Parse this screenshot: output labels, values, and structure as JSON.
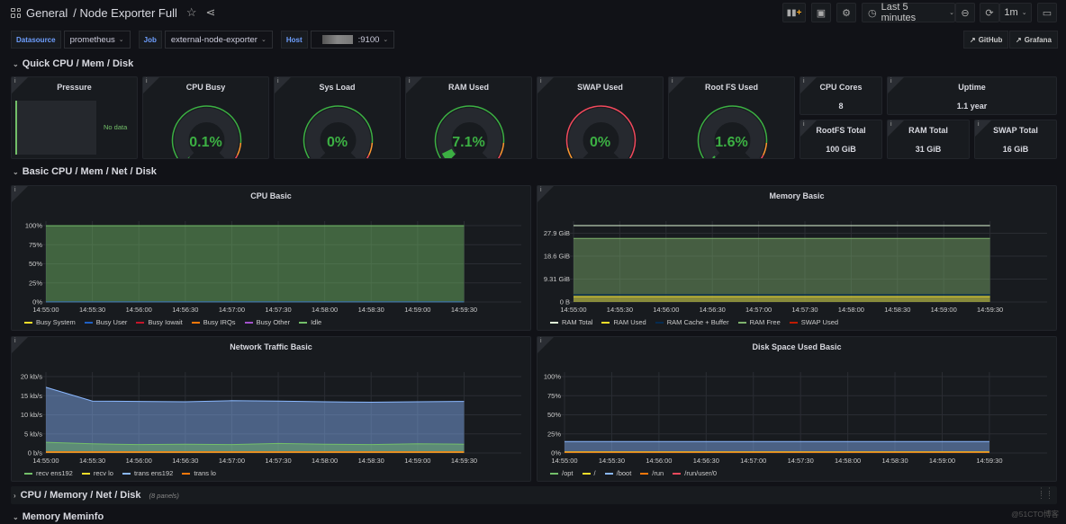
{
  "header": {
    "breadcrumb_folder": "General",
    "breadcrumb_dashboard": "/ Node Exporter Full",
    "time_range": "Last 5 minutes",
    "refresh_interval": "1m",
    "icons": [
      "add-panel-icon",
      "save-icon",
      "settings-icon",
      "clock-icon",
      "zoom-out-icon",
      "refresh-icon",
      "tv-mode-icon"
    ]
  },
  "variables": [
    {
      "label": "Datasource",
      "value": "prometheus"
    },
    {
      "label": "Job",
      "value": "external-node-exporter"
    },
    {
      "label": "Host",
      "value": ":9100"
    }
  ],
  "links": [
    {
      "label": "GitHub"
    },
    {
      "label": "Grafana"
    }
  ],
  "rows": {
    "quick": "Quick CPU / Mem / Disk",
    "basic": "Basic CPU / Mem / Net / Disk",
    "cpu_mem": "CPU / Memory / Net / Disk",
    "cpu_mem_count": "(8 panels)",
    "meminfo": "Memory Meminfo"
  },
  "stats": {
    "pressure": {
      "title": "Pressure",
      "value": "No data"
    },
    "cpu_busy": {
      "title": "CPU Busy",
      "value": "0.1%",
      "fraction": 0.001
    },
    "sys_load": {
      "title": "Sys Load",
      "value": "0%",
      "fraction": 0
    },
    "ram_used": {
      "title": "RAM Used",
      "value": "7.1%",
      "fraction": 0.071
    },
    "swap_used": {
      "title": "SWAP Used",
      "value": "0%",
      "fraction": 0
    },
    "root_fs_used": {
      "title": "Root FS Used",
      "value": "1.6%",
      "fraction": 0.016
    },
    "cpu_cores": {
      "title": "CPU Cores",
      "value": "8"
    },
    "uptime": {
      "title": "Uptime",
      "value": "1.1 year"
    },
    "rootfs_total": {
      "title": "RootFS Total",
      "value": "100 GiB"
    },
    "ram_total": {
      "title": "RAM Total",
      "value": "31 GiB"
    },
    "swap_total": {
      "title": "SWAP Total",
      "value": "16 GiB"
    }
  },
  "watermark": "@51CTO博客",
  "chart_data": [
    {
      "type": "area",
      "title": "CPU Basic",
      "x": [
        "14:55:00",
        "14:55:30",
        "14:56:00",
        "14:56:30",
        "14:57:00",
        "14:57:30",
        "14:58:00",
        "14:58:30",
        "14:59:00",
        "14:59:30"
      ],
      "yticks": [
        "0%",
        "25%",
        "50%",
        "75%",
        "100%"
      ],
      "ylim": [
        0,
        100
      ],
      "series": [
        {
          "name": "Busy System",
          "color": "#fade2a",
          "values": [
            0.1,
            0.1,
            0.1,
            0.1,
            0.1,
            0.1,
            0.1,
            0.1,
            0.1,
            0.1
          ]
        },
        {
          "name": "Busy User",
          "color": "#1f60c4",
          "values": [
            0.1,
            0.1,
            0.1,
            0.1,
            0.1,
            0.1,
            0.1,
            0.1,
            0.1,
            0.1
          ]
        },
        {
          "name": "Busy Iowait",
          "color": "#c4162a",
          "values": [
            0,
            0,
            0,
            0,
            0,
            0,
            0,
            0,
            0,
            0
          ]
        },
        {
          "name": "Busy IRQs",
          "color": "#ff780a",
          "values": [
            0,
            0,
            0,
            0,
            0,
            0,
            0,
            0,
            0,
            0
          ]
        },
        {
          "name": "Busy Other",
          "color": "#a352cc",
          "values": [
            0,
            0,
            0,
            0,
            0,
            0,
            0,
            0,
            0,
            0
          ]
        },
        {
          "name": "Idle",
          "color": "#73bf69",
          "values": [
            99.8,
            99.8,
            99.8,
            99.8,
            99.8,
            99.8,
            99.8,
            99.8,
            99.8,
            99.8
          ]
        }
      ]
    },
    {
      "type": "area",
      "title": "Memory Basic",
      "x": [
        "14:55:00",
        "14:55:30",
        "14:56:00",
        "14:56:30",
        "14:57:00",
        "14:57:30",
        "14:58:00",
        "14:58:30",
        "14:59:00",
        "14:59:30"
      ],
      "yticks": [
        "0 B",
        "9.31 GiB",
        "18.6 GiB",
        "27.9 GiB"
      ],
      "ylim": [
        0,
        31
      ],
      "series": [
        {
          "name": "RAM Total",
          "color": "#e0f9d7",
          "values": [
            31,
            31,
            31,
            31,
            31,
            31,
            31,
            31,
            31,
            31
          ]
        },
        {
          "name": "RAM Used",
          "color": "#fade2a",
          "values": [
            2.2,
            2.2,
            2.2,
            2.2,
            2.2,
            2.2,
            2.2,
            2.2,
            2.2,
            2.2
          ]
        },
        {
          "name": "RAM Cache + Buffer",
          "color": "#052b51",
          "values": [
            3,
            3,
            3,
            3,
            3,
            3,
            3,
            3,
            3,
            3
          ]
        },
        {
          "name": "RAM Free",
          "color": "#7eb26d",
          "values": [
            25.8,
            25.8,
            25.8,
            25.8,
            25.8,
            25.8,
            25.8,
            25.8,
            25.8,
            25.8
          ]
        },
        {
          "name": "SWAP Used",
          "color": "#bf1b00",
          "values": [
            0,
            0,
            0,
            0,
            0,
            0,
            0,
            0,
            0,
            0
          ]
        }
      ]
    },
    {
      "type": "area",
      "title": "Network Traffic Basic",
      "x": [
        "14:55:00",
        "14:55:30",
        "14:56:00",
        "14:56:30",
        "14:57:00",
        "14:57:30",
        "14:58:00",
        "14:58:30",
        "14:59:00",
        "14:59:30"
      ],
      "yticks": [
        "0 b/s",
        "5 kb/s",
        "10 kb/s",
        "15 kb/s",
        "20 kb/s"
      ],
      "ylim": [
        0,
        20
      ],
      "series": [
        {
          "name": "recv ens192",
          "color": "#73bf69",
          "values": [
            2.8,
            2.4,
            2.2,
            2.3,
            2.2,
            2.5,
            2.3,
            2.2,
            2.4,
            2.3
          ]
        },
        {
          "name": "recv lo",
          "color": "#fade2a",
          "values": [
            0.3,
            0.3,
            0.3,
            0.3,
            0.3,
            0.3,
            0.3,
            0.3,
            0.3,
            0.3
          ]
        },
        {
          "name": "trans ens192",
          "color": "#8ab8ff",
          "values": [
            17.2,
            13.6,
            13.5,
            13.4,
            13.7,
            13.6,
            13.4,
            13.3,
            13.4,
            13.5
          ]
        },
        {
          "name": "trans lo",
          "color": "#ff780a",
          "values": [
            0.3,
            0.3,
            0.3,
            0.3,
            0.3,
            0.3,
            0.3,
            0.3,
            0.3,
            0.3
          ]
        }
      ]
    },
    {
      "type": "area",
      "title": "Disk Space Used Basic",
      "x": [
        "14:55:00",
        "14:55:30",
        "14:56:00",
        "14:56:30",
        "14:57:00",
        "14:57:30",
        "14:58:00",
        "14:58:30",
        "14:59:00",
        "14:59:30"
      ],
      "yticks": [
        "0%",
        "25%",
        "50%",
        "75%",
        "100%"
      ],
      "ylim": [
        0,
        100
      ],
      "series": [
        {
          "name": "/opt",
          "color": "#73bf69",
          "values": [
            1,
            1,
            1,
            1,
            1,
            1,
            1,
            1,
            1,
            1
          ]
        },
        {
          "name": "/",
          "color": "#fade2a",
          "values": [
            1.6,
            1.6,
            1.6,
            1.6,
            1.6,
            1.6,
            1.6,
            1.6,
            1.6,
            1.6
          ]
        },
        {
          "name": "/boot",
          "color": "#8ab8ff",
          "values": [
            15,
            15,
            15,
            15,
            15,
            15,
            15,
            15,
            15,
            15
          ]
        },
        {
          "name": "/run",
          "color": "#ff780a",
          "values": [
            1,
            1,
            1,
            1,
            1,
            1,
            1,
            1,
            1,
            1
          ]
        },
        {
          "name": "/run/user/0",
          "color": "#f2495c",
          "values": [
            0,
            0,
            0,
            0,
            0,
            0,
            0,
            0,
            0,
            0
          ]
        }
      ]
    }
  ]
}
